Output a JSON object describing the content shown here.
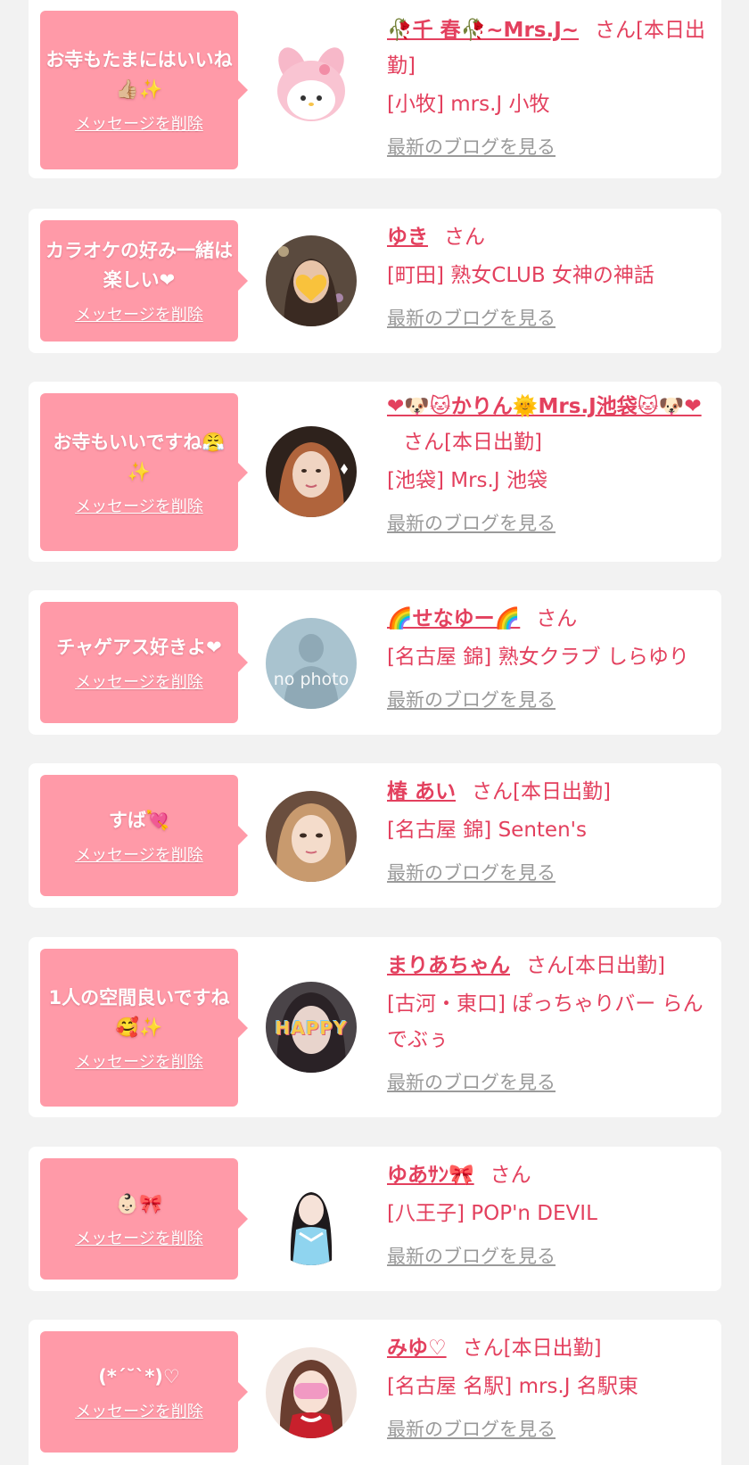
{
  "colors": {
    "background": "#f2f2f2",
    "card": "#ffffff",
    "bubble": "#ff9aa8",
    "name": "#e3405e",
    "link_gray": "#9a9a9a"
  },
  "cards": [
    {
      "message": "お寺もたまにはいいね👍🏼✨",
      "delete_label": "メッセージを削除",
      "name": "🥀千 春🥀~Mrs.J~",
      "suffix": "さん[本日出勤]",
      "shop": "[小牧] mrs.J 小牧",
      "blog_label": "最新のブログを見る",
      "avatar_icon": "pink-bunny-plush-avatar"
    },
    {
      "message": "カラオケの好み一緒は楽しい❤",
      "delete_label": "メッセージを削除",
      "name": "ゆき",
      "suffix": "さん",
      "shop": "[町田] 熟女CLUB 女神の神話",
      "blog_label": "最新のブログを見る",
      "avatar_icon": "woman-photo-avatar"
    },
    {
      "message": "お寺もいいですね😤✨",
      "delete_label": "メッセージを削除",
      "name": "❤🐶🐱かりん🌞Mrs.J池袋🐱🐶❤",
      "suffix": "さん[本日出勤]",
      "shop": "[池袋] Mrs.J 池袋",
      "blog_label": "最新のブログを見る",
      "avatar_icon": "woman-photo-avatar"
    },
    {
      "message": "チャゲアス好きよ❤",
      "delete_label": "メッセージを削除",
      "name": "🌈せなゆー🌈",
      "suffix": "さん",
      "shop": "[名古屋 錦] 熟女クラブ しらゆり",
      "blog_label": "最新のブログを見る",
      "avatar_icon": "no-photo-avatar",
      "avatar_text": "no photo"
    },
    {
      "message": "すば💘",
      "delete_label": "メッセージを削除",
      "name": "椿 あい",
      "suffix": "さん[本日出勤]",
      "shop": "[名古屋 錦] Senten's",
      "blog_label": "最新のブログを見る",
      "avatar_icon": "woman-photo-avatar"
    },
    {
      "message": "1人の空間良いですね🥰✨",
      "delete_label": "メッセージを削除",
      "name": "まりあちゃん",
      "suffix": "さん[本日出勤]",
      "shop": "[古河・東口] ぽっちゃりバー らんでぶぅ",
      "blog_label": "最新のブログを見る",
      "avatar_icon": "woman-photo-avatar",
      "avatar_text": "HAPPY"
    },
    {
      "message": "👶🏻🎀",
      "delete_label": "メッセージを削除",
      "name": "ゆあｻﾝ🎀",
      "suffix": "さん",
      "shop": "[八王子] POP'n DEVIL",
      "blog_label": "最新のブログを見る",
      "avatar_icon": "woman-photo-avatar"
    },
    {
      "message": "(*´˘`*)♡",
      "delete_label": "メッセージを削除",
      "name": "みゆ♡",
      "suffix": "さん[本日出勤]",
      "shop": "[名古屋 名駅] mrs.J 名駅東",
      "blog_label": "最新のブログを見る",
      "avatar_icon": "woman-photo-avatar"
    }
  ]
}
